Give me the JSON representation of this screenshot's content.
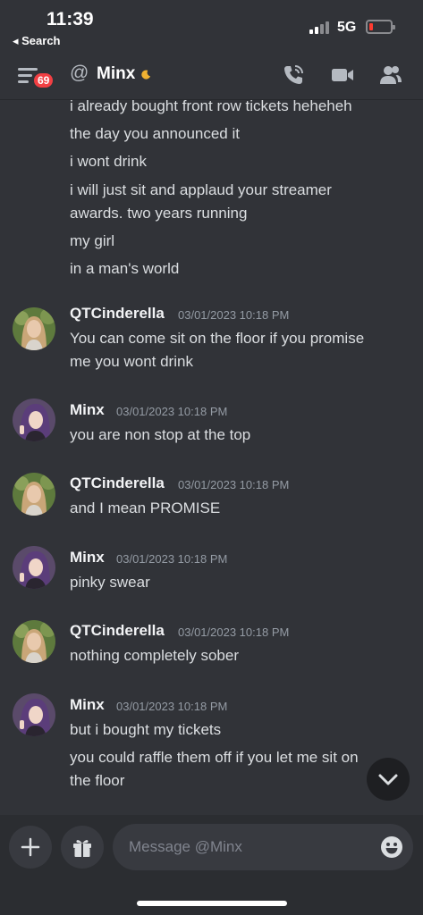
{
  "status_bar": {
    "time": "11:39",
    "back_label": "◂ Search",
    "network": "5G"
  },
  "header": {
    "unread_badge": "69",
    "at_symbol": "@",
    "channel_name": "Minx",
    "icons": [
      "menu-icon",
      "moon-icon",
      "phone-call-icon",
      "video-icon",
      "members-icon"
    ]
  },
  "messages": {
    "continued": [
      "i already bought front row tickets heheheh",
      "the day you announced it",
      "i wont drink",
      "i will just sit and applaud your streamer",
      "awards. two years running",
      "my girl",
      "in a man's world"
    ],
    "groups": [
      {
        "author": "QTCinderella",
        "timestamp": "03/01/2023 10:18 PM",
        "lines": [
          "You can come sit on the floor if you promise",
          "me you wont drink"
        ]
      },
      {
        "author": "Minx",
        "timestamp": "03/01/2023 10:18 PM",
        "lines": [
          "you are non stop at the top"
        ]
      },
      {
        "author": "QTCinderella",
        "timestamp": "03/01/2023 10:18 PM",
        "lines": [
          "and I mean PROMISE"
        ]
      },
      {
        "author": "Minx",
        "timestamp": "03/01/2023 10:18 PM",
        "lines": [
          "pinky swear"
        ]
      },
      {
        "author": "QTCinderella",
        "timestamp": "03/01/2023 10:18 PM",
        "lines": [
          "nothing completely sober"
        ]
      },
      {
        "author": "Minx",
        "timestamp": "03/01/2023 10:18 PM",
        "lines": [
          "but i bought my tickets",
          "you could raffle them off if you let me sit on",
          "the floor"
        ]
      }
    ]
  },
  "composer": {
    "placeholder": "Message @Minx"
  },
  "colors": {
    "background": "#313338",
    "composer_bg": "#2b2d31",
    "badge": "#f23f43",
    "battery_low": "#ff3b30"
  }
}
